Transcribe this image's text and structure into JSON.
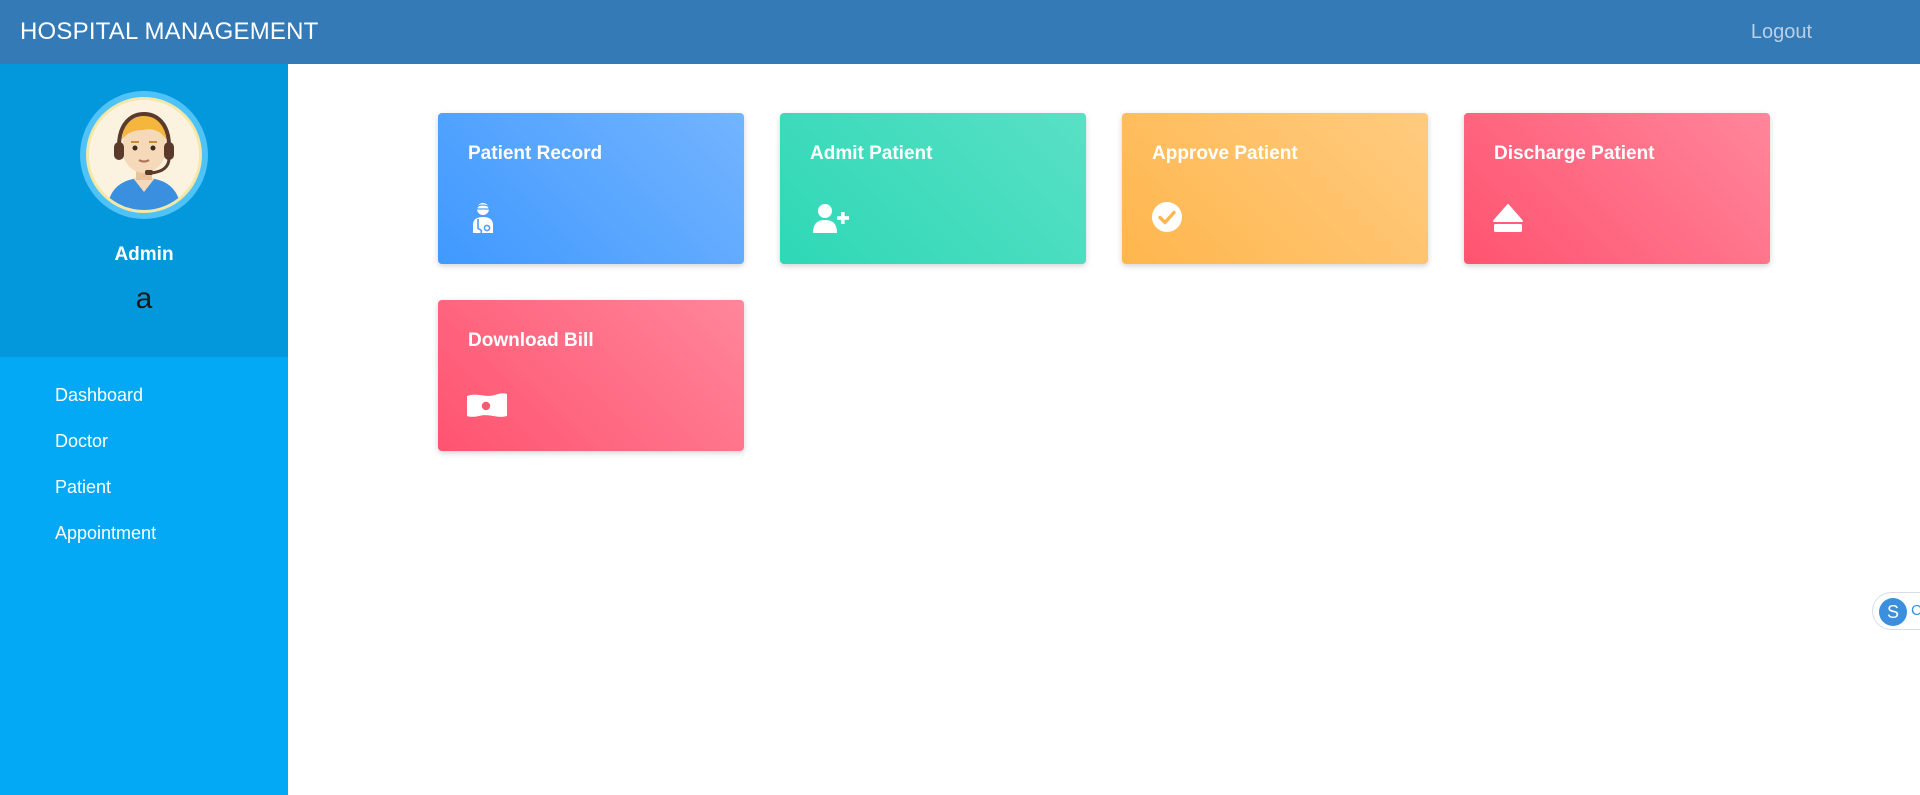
{
  "header": {
    "brand": "HOSPITAL MANAGEMENT",
    "logout": "Logout",
    "background": "#337ab7"
  },
  "sidebar": {
    "profile": {
      "name": "Admin",
      "subtitle": "a",
      "avatar_icon": "support-agent-avatar"
    },
    "items": [
      {
        "label": "Dashboard"
      },
      {
        "label": "Doctor"
      },
      {
        "label": "Patient"
      },
      {
        "label": "Appointment"
      }
    ],
    "background": "#03a9f4"
  },
  "cards": [
    {
      "title": "Patient Record",
      "icon": "user-injured-icon",
      "color": "#4099ff"
    },
    {
      "title": "Admit Patient",
      "icon": "user-plus-icon",
      "color": "#2ed8b6"
    },
    {
      "title": "Approve Patient",
      "icon": "check-circle-icon",
      "color": "#ffb64d"
    },
    {
      "title": "Discharge Patient",
      "icon": "eject-icon",
      "color": "#ff5370"
    },
    {
      "title": "Download Bill",
      "icon": "money-bill-icon",
      "color": "#ff5370"
    }
  ],
  "chat_widget": {
    "icon_letter": "S",
    "partial_text": "C"
  }
}
